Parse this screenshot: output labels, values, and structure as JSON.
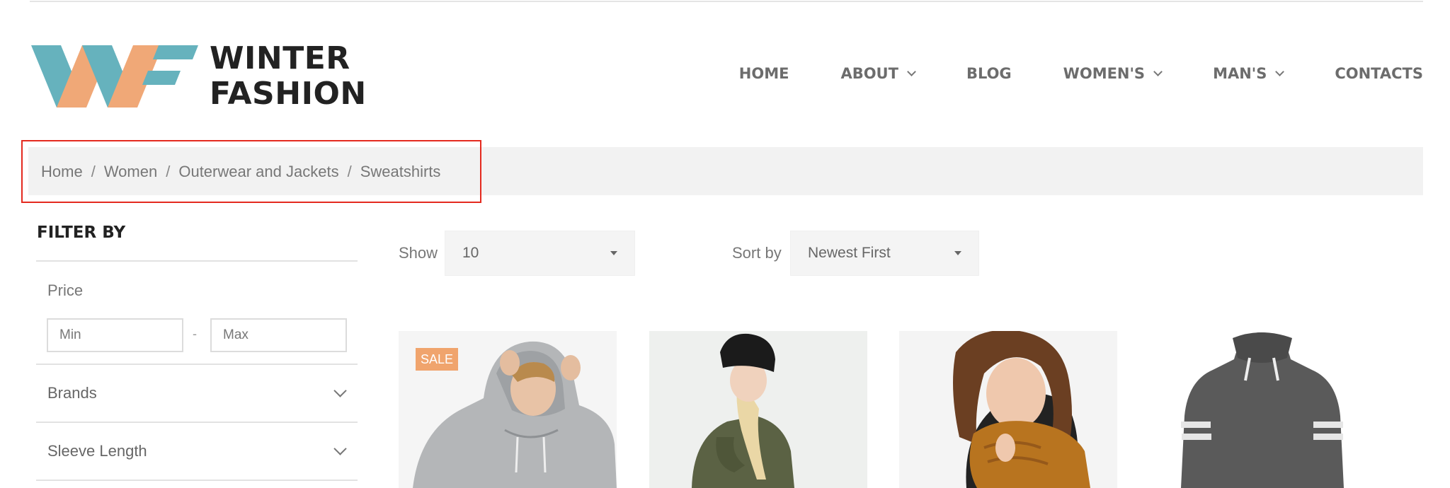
{
  "brand": {
    "line1": "WINTER",
    "line2": "FASHION"
  },
  "nav": [
    {
      "label": "HOME",
      "dropdown": false
    },
    {
      "label": "ABOUT",
      "dropdown": true
    },
    {
      "label": "BLOG",
      "dropdown": false
    },
    {
      "label": "WOMEN'S",
      "dropdown": true
    },
    {
      "label": "MAN'S",
      "dropdown": true
    },
    {
      "label": "CONTACTS",
      "dropdown": false
    }
  ],
  "breadcrumb": {
    "items": [
      "Home",
      "Women",
      "Outerwear and Jackets",
      "Sweatshirts"
    ],
    "separator": "/"
  },
  "sidebar": {
    "title": "FILTER BY",
    "price": {
      "label": "Price",
      "min_placeholder": "Min",
      "max_placeholder": "Max",
      "dash": "-"
    },
    "filters": [
      {
        "label": "Brands"
      },
      {
        "label": "Sleeve Length"
      }
    ]
  },
  "toolbar": {
    "show_label": "Show",
    "show_value": "10",
    "sort_label": "Sort by",
    "sort_value": "Newest First"
  },
  "products": [
    {
      "badge": "SALE",
      "image": "man-grey-hoodie"
    },
    {
      "badge": "",
      "image": "woman-olive-sweater-beanie"
    },
    {
      "badge": "",
      "image": "woman-mustard-scarf"
    },
    {
      "badge": "",
      "image": "grey-striped-hoodie"
    }
  ],
  "colors": {
    "logo_teal": "#66b2bd",
    "logo_orange": "#f0a877",
    "sale_badge": "#f0a46d",
    "highlight": "#e42a1f"
  }
}
